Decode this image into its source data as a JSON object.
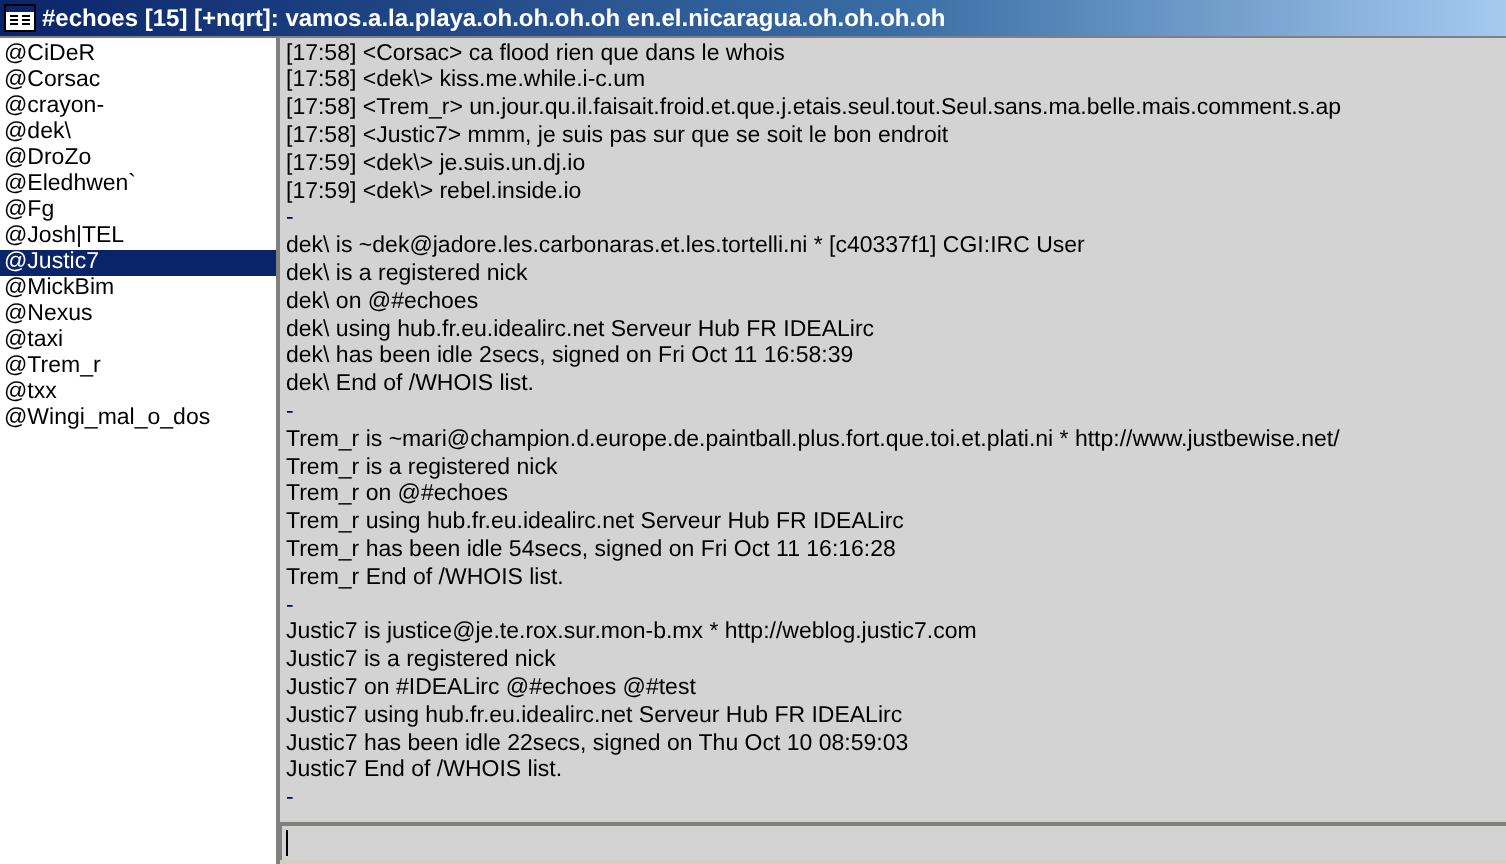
{
  "window": {
    "title": "#echoes [15] [+nqrt]: vamos.a.la.playa.oh.oh.oh.oh en.el.nicaragua.oh.oh.oh.oh"
  },
  "nicklist": [
    {
      "nick": "@CiDeR",
      "selected": false
    },
    {
      "nick": "@Corsac",
      "selected": false
    },
    {
      "nick": "@crayon-",
      "selected": false
    },
    {
      "nick": "@dek\\",
      "selected": false
    },
    {
      "nick": "@DroZo",
      "selected": false
    },
    {
      "nick": "@Eledhwen`",
      "selected": false
    },
    {
      "nick": "@Fg",
      "selected": false
    },
    {
      "nick": "@Josh|TEL",
      "selected": false
    },
    {
      "nick": "@Justic7",
      "selected": true
    },
    {
      "nick": "@MickBim",
      "selected": false
    },
    {
      "nick": "@Nexus",
      "selected": false
    },
    {
      "nick": "@taxi",
      "selected": false
    },
    {
      "nick": "@Trem_r",
      "selected": false
    },
    {
      "nick": "@txx",
      "selected": false
    },
    {
      "nick": "@Wingi_mal_o_dos",
      "selected": false
    }
  ],
  "chat_lines": [
    {
      "kind": "message",
      "text": "[17:58] <Corsac> ca flood rien que dans le whois"
    },
    {
      "kind": "message",
      "text": "[17:58] <dek\\> kiss.me.while.i-c.um"
    },
    {
      "kind": "message",
      "text": "[17:58] <Trem_r> un.jour.qu.il.faisait.froid.et.que.j.etais.seul.tout.Seul.sans.ma.belle.mais.comment.s.ap"
    },
    {
      "kind": "message",
      "text": "[17:58] <Justic7> mmm, je suis pas sur que se soit le bon endroit"
    },
    {
      "kind": "message",
      "text": "[17:59] <dek\\> je.suis.un.dj.io"
    },
    {
      "kind": "message",
      "text": "[17:59] <dek\\> rebel.inside.io"
    },
    {
      "kind": "separator",
      "text": "-"
    },
    {
      "kind": "info",
      "text": "dek\\ is ~dek@jadore.les.carbonaras.et.les.tortelli.ni * [c40337f1] CGI:IRC User"
    },
    {
      "kind": "info",
      "text": "dek\\ is a registered nick"
    },
    {
      "kind": "info",
      "text": "dek\\ on @#echoes"
    },
    {
      "kind": "info",
      "text": "dek\\ using hub.fr.eu.idealirc.net Serveur Hub FR IDEALirc"
    },
    {
      "kind": "info",
      "text": "dek\\ has been idle 2secs, signed on Fri Oct 11 16:58:39"
    },
    {
      "kind": "info",
      "text": "dek\\ End of /WHOIS list."
    },
    {
      "kind": "separator",
      "text": "-"
    },
    {
      "kind": "info",
      "text": "Trem_r is ~mari@champion.d.europe.de.paintball.plus.fort.que.toi.et.plati.ni * http://www.justbewise.net/"
    },
    {
      "kind": "info",
      "text": "Trem_r is a registered nick"
    },
    {
      "kind": "info",
      "text": "Trem_r on @#echoes"
    },
    {
      "kind": "info",
      "text": "Trem_r using hub.fr.eu.idealirc.net Serveur Hub FR IDEALirc"
    },
    {
      "kind": "info",
      "text": "Trem_r has been idle 54secs, signed on Fri Oct 11 16:16:28"
    },
    {
      "kind": "info",
      "text": "Trem_r End of /WHOIS list."
    },
    {
      "kind": "separator",
      "text": "-"
    },
    {
      "kind": "info",
      "text": "Justic7 is justice@je.te.rox.sur.mon-b.mx * http://weblog.justic7.com"
    },
    {
      "kind": "info",
      "text": "Justic7 is a registered nick"
    },
    {
      "kind": "info",
      "text": "Justic7 on #IDEALirc @#echoes @#test"
    },
    {
      "kind": "info",
      "text": "Justic7 using hub.fr.eu.idealirc.net Serveur Hub FR IDEALirc"
    },
    {
      "kind": "info",
      "text": "Justic7 has been idle 22secs, signed on Thu Oct 10 08:59:03"
    },
    {
      "kind": "info",
      "text": "Justic7 End of /WHOIS list."
    },
    {
      "kind": "separator",
      "text": "-"
    }
  ]
}
